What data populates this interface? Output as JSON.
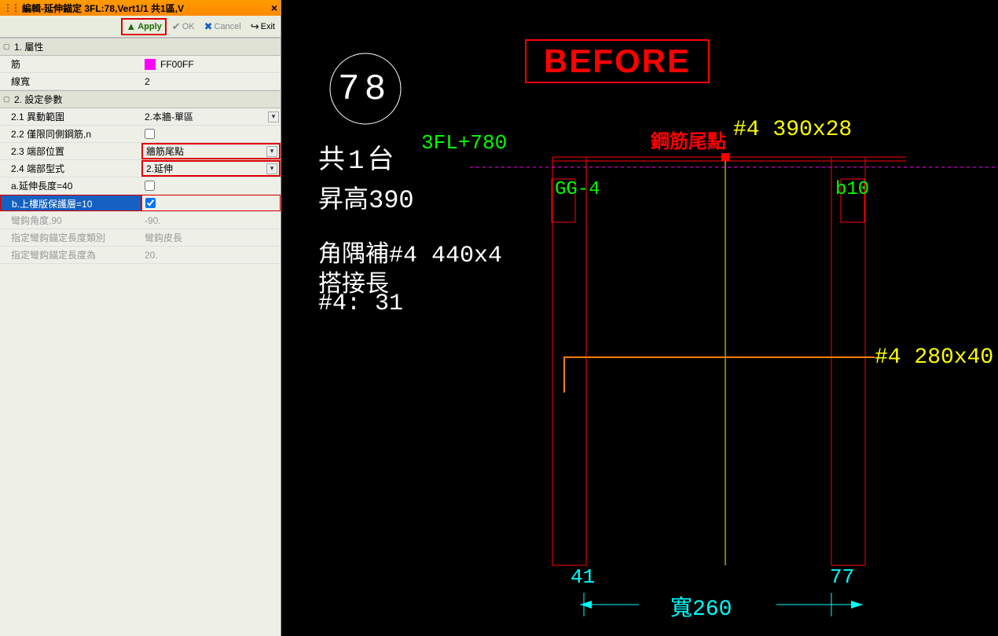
{
  "titlebar": {
    "text": "編輯-延伸錨定 3FL:78,Vert1/1 共1區,V",
    "close": "×"
  },
  "toolbar": {
    "apply": "Apply",
    "ok": "OK",
    "cancel": "Cancel",
    "exit": "Exit"
  },
  "sections": {
    "s1": {
      "title": "1. 屬性"
    },
    "s2": {
      "title": "2. 設定參數"
    }
  },
  "rows": {
    "reinf_lbl": "筋",
    "reinf_val": "FF00FF",
    "lw_lbl": "線寬",
    "lw_val": "2",
    "r21_lbl": "2.1 異動範圍",
    "r21_val": "2.本牆-單區",
    "r22_lbl": "2.2 僅限同側鋼筋,n",
    "r23_lbl": "2.3 端部位置",
    "r23_val": "牆筋尾點",
    "r24_lbl": "2.4 端部型式",
    "r24_val": "2.延伸",
    "ra_lbl": "a.延伸長度=40",
    "rb_lbl": "b.上樓版保護層=10",
    "hookang_lbl": "彎鈎角度,90",
    "hookang_val": "-90.",
    "hooklen_lbl": "指定彎鈎錨定長度類別",
    "hooklen_val": "彎鈎皮長",
    "hookval_lbl": "指定彎鈎錨定長度為",
    "hookval_val": "20."
  },
  "cad": {
    "before": "BEFORE",
    "circle": "78",
    "unit": "共1台",
    "rise": "昇高390",
    "corner": "角隅補#4 440x4",
    "lap1": "搭接長",
    "lap2": "#4: 31",
    "level": "3FL+780",
    "tailpoint": "鋼筋尾點",
    "spec1": "#4 390x28",
    "spec2": "#4 280x40",
    "gg4": "GG-4",
    "b10": "b10",
    "dim41": "41",
    "dim77": "77",
    "width": "寬260"
  },
  "colors": {
    "swatch": "#ff00ff"
  }
}
